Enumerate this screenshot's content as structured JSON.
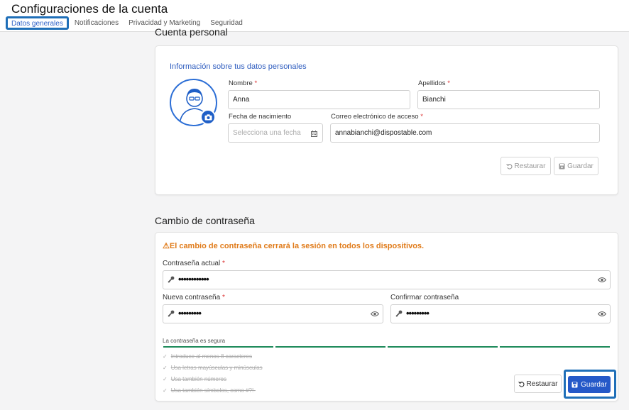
{
  "header": {
    "title": "Configuraciones de la cuenta",
    "tabs": [
      {
        "label": "Datos generales",
        "active": true
      },
      {
        "label": "Notificaciones",
        "active": false
      },
      {
        "label": "Privacidad y Marketing",
        "active": false
      },
      {
        "label": "Seguridad",
        "active": false
      }
    ]
  },
  "personal": {
    "heading": "Cuenta personal",
    "info_title": "Información sobre tus datos personales",
    "fields": {
      "nombre_label": "Nombre",
      "nombre_value": "Anna",
      "apellidos_label": "Apellidos",
      "apellidos_value": "Bianchi",
      "fecha_label": "Fecha de nacimiento",
      "fecha_placeholder": "Selecciona una fecha",
      "correo_label": "Correo electrónico de acceso",
      "correo_value": "annabianchi@dispostable.com"
    },
    "restore_label": "Restaurar",
    "save_label": "Guardar"
  },
  "password": {
    "heading": "Cambio de contraseña",
    "warning": "El cambio de contraseña cerrará la sesión en todos los dispositivos.",
    "current_label": "Contraseña actual",
    "current_value": "••••••••••••",
    "new_label": "Nueva contraseña",
    "new_value": "•••••••••",
    "confirm_label": "Confirmar contraseña",
    "confirm_value": "•••••••••",
    "strength_text": "La contraseña es segura",
    "requirements": [
      "Introduce al menos 8 caracteres",
      "Usa letras mayúsculas y minúsculas",
      "Usa también números",
      "Usa también símbolos, como #?!-"
    ],
    "restore_label": "Restaurar",
    "save_label": "Guardar"
  },
  "colors": {
    "accent": "#2559c8",
    "highlight": "#1f6fb8",
    "warning": "#e07b1a",
    "strength": "#1d8a5a",
    "required": "#d33333"
  },
  "icons": [
    "camera-icon",
    "calendar-icon",
    "key-icon",
    "eye-icon",
    "undo-icon",
    "save-icon",
    "warning-icon",
    "check-icon"
  ]
}
